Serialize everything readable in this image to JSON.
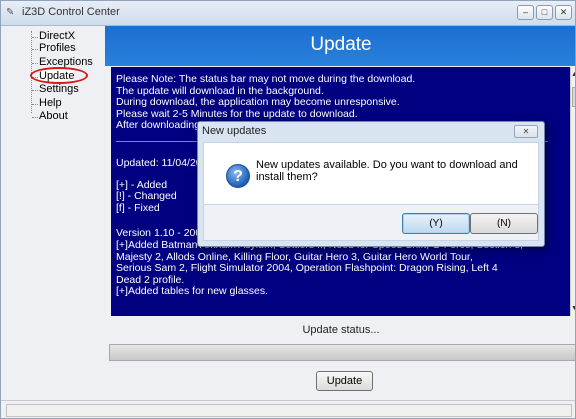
{
  "window": {
    "title": "iZ3D Control Center",
    "icon": "app-logo-icon"
  },
  "nav": {
    "items": [
      {
        "label": "DirectX"
      },
      {
        "label": "Profiles"
      },
      {
        "label": "Exceptions"
      },
      {
        "label": "Update"
      },
      {
        "label": "Settings"
      },
      {
        "label": "Help"
      },
      {
        "label": "About"
      }
    ],
    "selected": "Update",
    "highlight_color": "#d51b1b"
  },
  "page": {
    "title": "Update"
  },
  "log": {
    "notes": [
      "Please Note: The status bar may not move during the download.",
      "The update will download in the background.",
      "During download, the application may become unresponsive.",
      "Please wait 2-5 Minutes for the update to download.",
      "After downloading"
    ],
    "updated": "Updated: 11/04/20",
    "legend": [
      "[+] - Added",
      "[!] - Changed",
      "[f] - Fixed"
    ],
    "changes": [
      "Version 1.10 - 200",
      "[+]Added Batman Arkham Asylum, Settlers II, Need for Speed Shift, G-Force, Section 8,",
      "Majesty 2, Allods Online, Killing Floor, Guitar Hero 3, Guitar Hero World Tour,",
      "Serious Sam 2, Flight Simulator 2004, Operation Flashpoint: Dragon Rising, Left 4",
      "Dead 2 profile.",
      "[+]Added tables for new glasses."
    ],
    "background": "#000080"
  },
  "status": {
    "label": "Update status...",
    "progress": 0
  },
  "update_button": "Update",
  "dialog": {
    "title": "New updates",
    "message": "New updates available. Do you want to download and install them?",
    "yes_label": "(Y)",
    "no_label": "(N)",
    "icon": "question-icon"
  }
}
